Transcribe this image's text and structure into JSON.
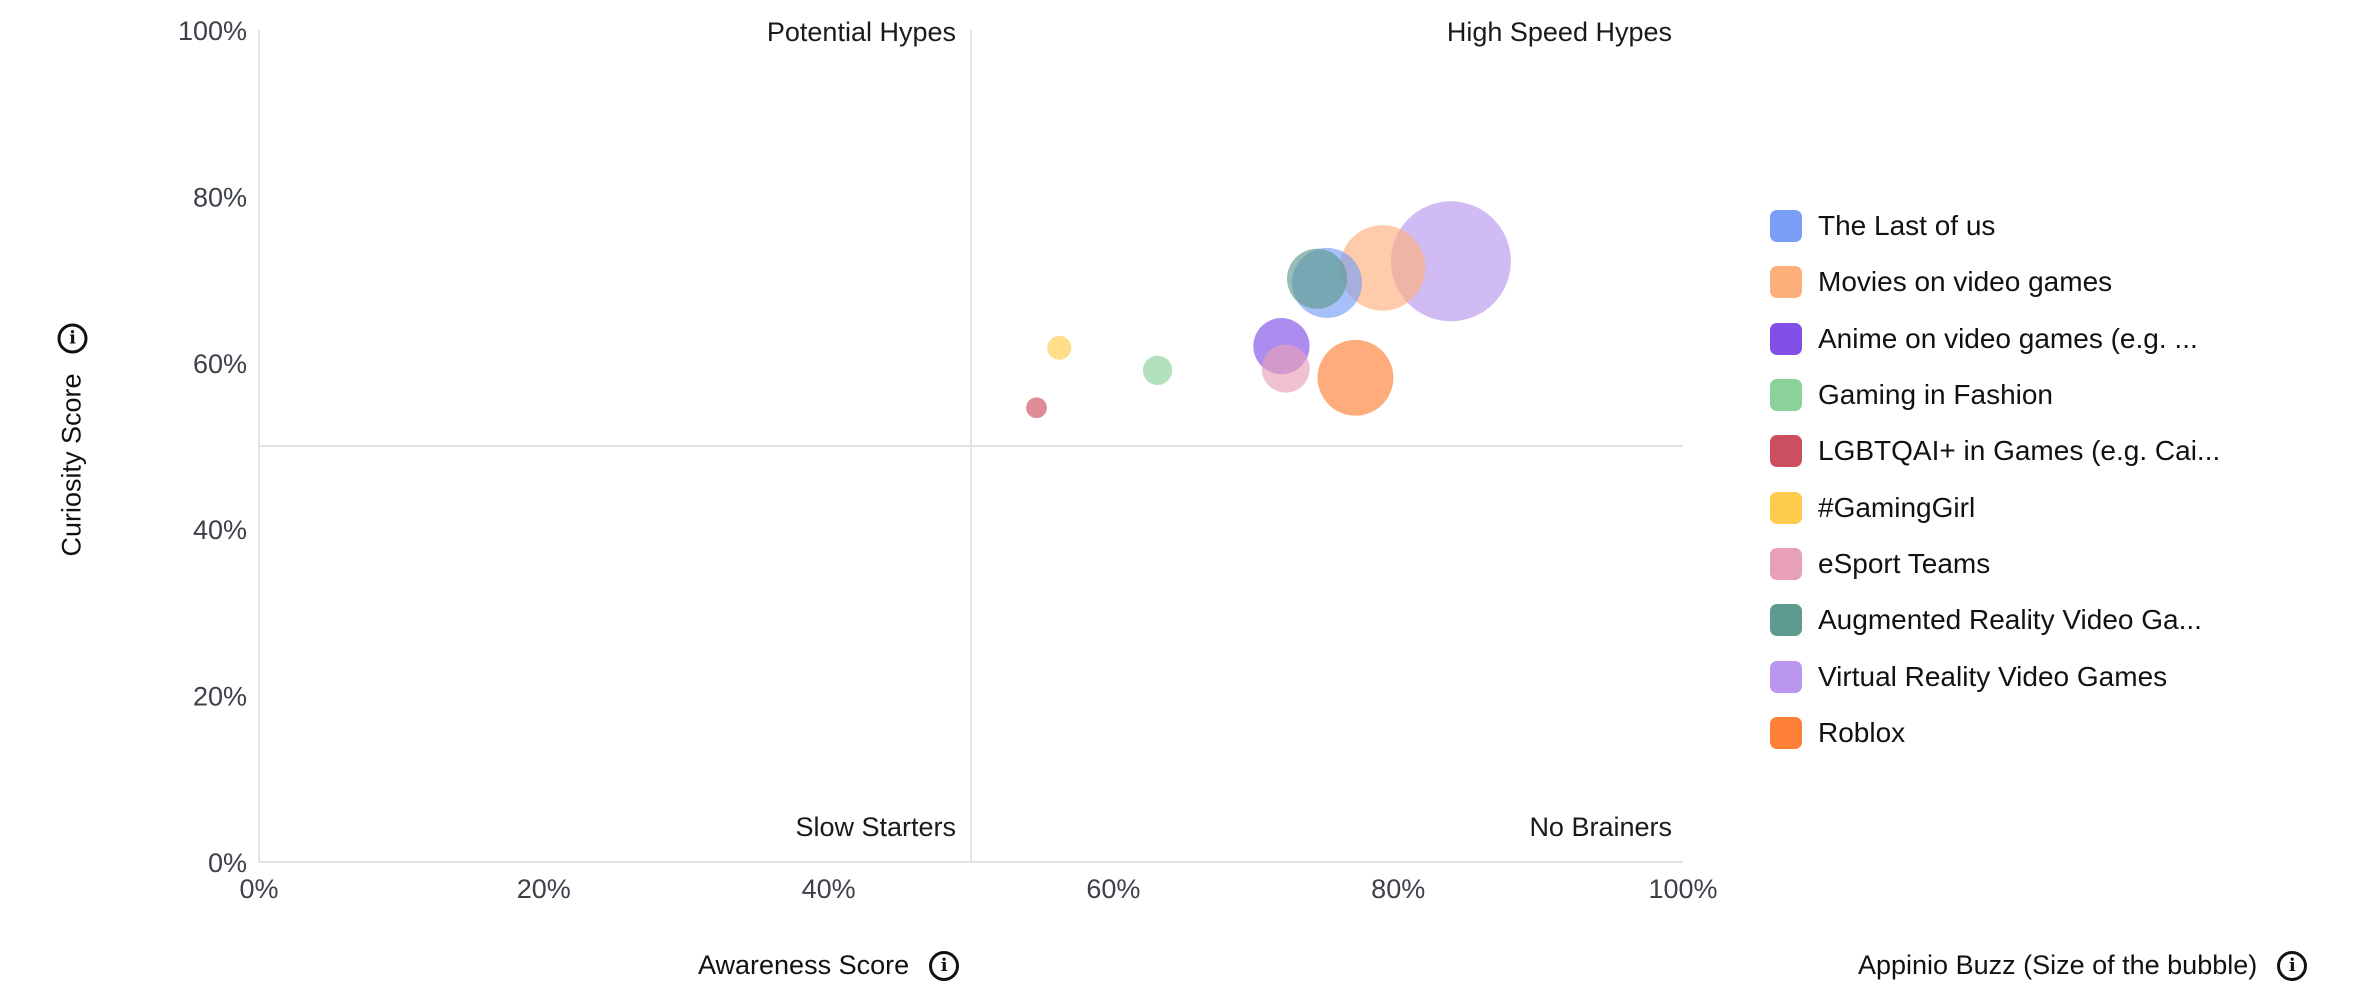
{
  "chart_data": {
    "type": "scatter",
    "subtype": "bubble",
    "title": "",
    "xlabel": "Awareness Score",
    "ylabel": "Curiosity Score",
    "size_label": "Appinio Buzz (Size of the bubble)",
    "xlim": [
      0,
      100
    ],
    "ylim": [
      0,
      100
    ],
    "x_ticks": [
      "0%",
      "20%",
      "40%",
      "60%",
      "80%",
      "100%"
    ],
    "y_ticks": [
      "0%",
      "20%",
      "40%",
      "60%",
      "80%",
      "100%"
    ],
    "tick_values": [
      0,
      20,
      40,
      60,
      80,
      100
    ],
    "quadrant_split": {
      "x": 50,
      "y": 50
    },
    "quadrants": {
      "top_left": "Potential Hypes",
      "top_right": "High Speed Hypes",
      "bottom_left": "Slow Starters",
      "bottom_right": "No Brainers"
    },
    "grid": false,
    "legend_position": "right",
    "series": [
      {
        "name": "The Last of us",
        "x": 75.0,
        "y": 69.6,
        "buzz": 34,
        "color": "#7a9ef8"
      },
      {
        "name": "Movies on video games",
        "x": 78.9,
        "y": 71.4,
        "buzz": 51,
        "color": "#fdb07c"
      },
      {
        "name": "Anime on video games (e.g. ...",
        "x": 71.8,
        "y": 62.0,
        "buzz": 22,
        "color": "#8050e6"
      },
      {
        "name": "Gaming in Fashion",
        "x": 63.1,
        "y": 59.1,
        "buzz": 6,
        "color": "#8ad19a"
      },
      {
        "name": "LGBTQAI+ in Games (e.g. Cai...",
        "x": 54.6,
        "y": 54.6,
        "buzz": 3,
        "color": "#cc4f60"
      },
      {
        "name": "#GamingGirl",
        "x": 56.2,
        "y": 61.8,
        "buzz": 4,
        "color": "#fecb4d"
      },
      {
        "name": "eSport Teams",
        "x": 72.1,
        "y": 59.3,
        "buzz": 16,
        "color": "#e8a0b8"
      },
      {
        "name": "Augmented Reality Video Ga...",
        "x": 74.3,
        "y": 70.1,
        "buzz": 25,
        "color": "#5e9a8f"
      },
      {
        "name": "Virtual Reality Video Games",
        "x": 83.7,
        "y": 72.2,
        "buzz": 100,
        "color": "#b997ee"
      },
      {
        "name": "Roblox",
        "x": 77.0,
        "y": 58.2,
        "buzz": 40,
        "color": "#fe7f36"
      }
    ]
  },
  "icons": {
    "info": "i"
  }
}
